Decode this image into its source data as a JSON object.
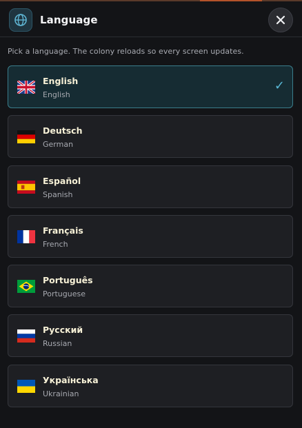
{
  "dialog": {
    "title": "Language",
    "subtitle": "Pick a language. The colony reloads so every screen updates.",
    "icon": "globe-icon",
    "close_icon": "close-icon"
  },
  "languages": [
    {
      "native": "English",
      "english": "English",
      "flag": "uk-flag-icon",
      "selected": true
    },
    {
      "native": "Deutsch",
      "english": "German",
      "flag": "germany-flag-icon",
      "selected": false
    },
    {
      "native": "Español",
      "english": "Spanish",
      "flag": "spain-flag-icon",
      "selected": false
    },
    {
      "native": "Français",
      "english": "French",
      "flag": "france-flag-icon",
      "selected": false
    },
    {
      "native": "Português",
      "english": "Portuguese",
      "flag": "brazil-flag-icon",
      "selected": false
    },
    {
      "native": "Русский",
      "english": "Russian",
      "flag": "russia-flag-icon",
      "selected": false
    },
    {
      "native": "Українська",
      "english": "Ukrainian",
      "flag": "ukraine-flag-icon",
      "selected": false
    }
  ],
  "selected_check": "✓",
  "colors": {
    "accent": "#58b8d6",
    "selected_border": "#3b7e8c",
    "native_text": "#f6f0d6"
  }
}
